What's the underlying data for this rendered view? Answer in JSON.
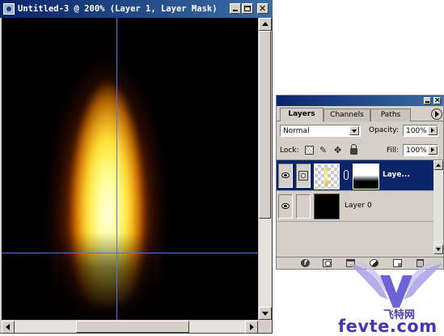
{
  "document": {
    "title": "Untitled-3 @ 200% (Layer 1, Layer Mask)"
  },
  "layers_palette": {
    "tabs": [
      "Layers",
      "Channels",
      "Paths"
    ],
    "active_tab": "Layers",
    "blend_mode": "Normal",
    "opacity_label": "Opacity:",
    "opacity_value": "100%",
    "lock_label": "Lock:",
    "fill_label": "Fill:",
    "fill_value": "100%",
    "layers": [
      {
        "name": "Laye...",
        "selected": true,
        "visible": true,
        "has_mask": true
      },
      {
        "name": "Layer 0",
        "selected": false,
        "visible": true,
        "has_mask": false
      }
    ]
  },
  "icons": {
    "window": [
      "app-icon",
      "minimize-icon",
      "maximize-icon",
      "close-icon"
    ],
    "palette_bottom": [
      "layer-style-icon",
      "add-mask-icon",
      "new-set-icon",
      "adjustment-layer-icon",
      "new-layer-icon",
      "trash-icon"
    ]
  },
  "watermark": {
    "chinese": "飞特网",
    "site": "fevte.com"
  },
  "colors": {
    "titlebar": "#0a246a",
    "selection": "#0a246a",
    "guide": "#5870e8",
    "watermark": "#4536b8"
  }
}
